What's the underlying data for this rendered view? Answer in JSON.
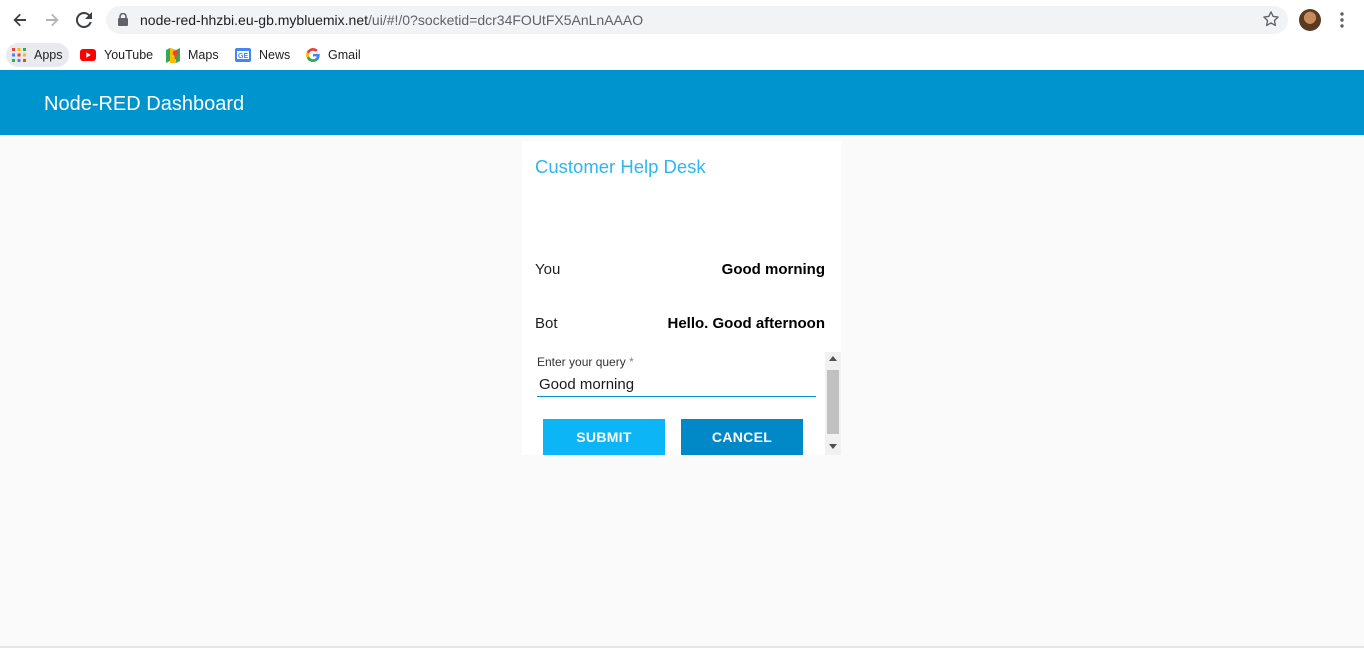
{
  "browser": {
    "url_host": "node-red-hhzbi.eu-gb.mybluemix.net",
    "url_path": "/ui/#!/0?socketid=dcr34FOUtFX5AnLnAAAO",
    "bookmarks": [
      {
        "label": "Apps",
        "icon": "apps-grid-icon"
      },
      {
        "label": "YouTube",
        "icon": "youtube-icon"
      },
      {
        "label": "Maps",
        "icon": "maps-icon"
      },
      {
        "label": "News",
        "icon": "news-icon"
      },
      {
        "label": "Gmail",
        "icon": "google-icon"
      }
    ]
  },
  "dashboard": {
    "title": "Node-RED Dashboard",
    "header_color": "#0094ce"
  },
  "card": {
    "title": "Customer Help Desk",
    "messages": [
      {
        "who": "You",
        "text": "Good morning"
      },
      {
        "who": "Bot",
        "text": "Hello. Good afternoon"
      }
    ],
    "query_label": "Enter your query",
    "query_required_marker": "*",
    "query_value": "Good morning",
    "submit_label": "SUBMIT",
    "cancel_label": "CANCEL",
    "title_color": "#2eb6ee",
    "submit_color": "#0cb5f5",
    "cancel_color": "#0188c6"
  }
}
